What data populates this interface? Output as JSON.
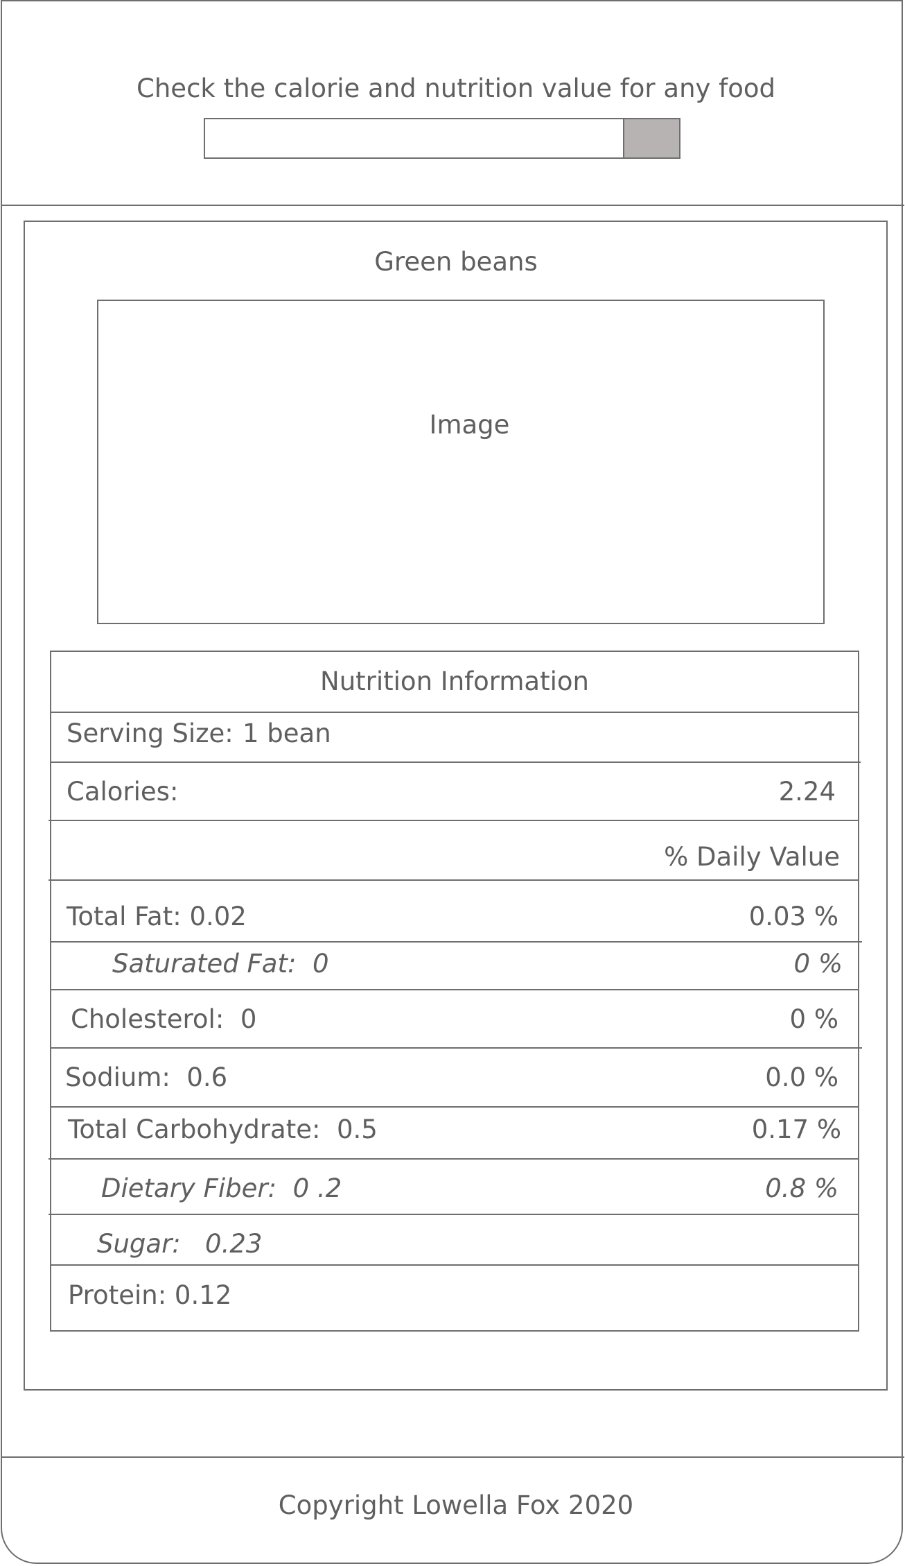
{
  "header": {
    "tagline": "Check the calorie and nutrition value for any food",
    "search": {
      "value": "",
      "placeholder": ""
    },
    "search_button_icon": "plain-gray-button"
  },
  "food": {
    "name": "Green beans",
    "image_placeholder": "Image"
  },
  "nutrition": {
    "title": "Nutrition Information",
    "serving_label": "Serving Size:",
    "serving_value": "1 bean",
    "calories_label": "Calories:",
    "calories_value": "2.24",
    "daily_value_header": "% Daily Value",
    "rows": [
      {
        "label": "Total Fat: 0.02",
        "dv": "0.03 %"
      },
      {
        "label": "Saturated Fat:  0",
        "dv": "0 %"
      },
      {
        "label": "Cholesterol:  0",
        "dv": "0 %"
      },
      {
        "label": "Sodium:  0.6",
        "dv": "0.0 %"
      },
      {
        "label": "Total Carbohydrate:  0.5",
        "dv": "0.17 %"
      },
      {
        "label": "Dietary Fiber:  0 .2",
        "dv": "0.8 %"
      },
      {
        "label": "Sugar:   0.23",
        "dv": ""
      },
      {
        "label": "Protein: 0.12",
        "dv": ""
      }
    ]
  },
  "footer": {
    "copyright": "Copyright Lowella Fox 2020"
  },
  "colors": {
    "border": "#6e6e6e",
    "text": "#5f5f5f",
    "button": "#b7b3b3",
    "background": "#ffffff"
  }
}
